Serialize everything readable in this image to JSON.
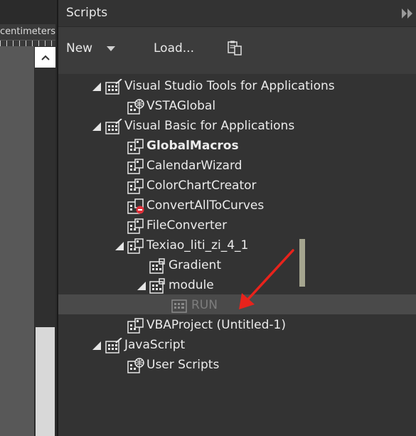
{
  "left_panel": {
    "ruler_unit": "centimeters",
    "scroll_up_glyph": "^"
  },
  "header": {
    "title": "Scripts",
    "expand_glyph": "▸▸"
  },
  "toolbar": {
    "new_label": "New",
    "load_label": "Load..."
  },
  "tree": {
    "items": [
      {
        "label": "Visual Studio Tools for Applications",
        "icon": "container-icon",
        "expanded": true,
        "level": 0
      },
      {
        "label": "VSTAGlobal",
        "icon": "globe-project-icon",
        "expanded": false,
        "level": 1
      },
      {
        "label": "Visual Basic for Applications",
        "icon": "container-icon",
        "expanded": true,
        "level": 0
      },
      {
        "label": "GlobalMacros",
        "icon": "project-icon",
        "expanded": false,
        "level": 1,
        "bold": true
      },
      {
        "label": "CalendarWizard",
        "icon": "project-icon",
        "expanded": false,
        "level": 1
      },
      {
        "label": "ColorChartCreator",
        "icon": "project-icon",
        "expanded": false,
        "level": 1
      },
      {
        "label": "ConvertAllToCurves",
        "icon": "project-error-icon",
        "expanded": false,
        "level": 1
      },
      {
        "label": "FileConverter",
        "icon": "project-icon",
        "expanded": false,
        "level": 1
      },
      {
        "label": "Texiao_liti_zi_4_1",
        "icon": "project-icon",
        "expanded": true,
        "level": 1
      },
      {
        "label": "Gradient",
        "icon": "module-icon",
        "level": 2
      },
      {
        "label": "module",
        "icon": "module-icon",
        "expanded": true,
        "level": 2
      },
      {
        "label": "RUN",
        "icon": "macro-icon",
        "level": 3,
        "selected": true
      },
      {
        "label": "VBAProject (Untitled-1)",
        "icon": "project-icon",
        "expanded": false,
        "level": 1
      },
      {
        "label": "JavaScript",
        "icon": "container-icon",
        "expanded": true,
        "level": 0
      },
      {
        "label": "User Scripts",
        "icon": "globe-project-icon",
        "level": 1
      }
    ]
  },
  "annotation": {
    "arrow_color": "#e8231c"
  }
}
